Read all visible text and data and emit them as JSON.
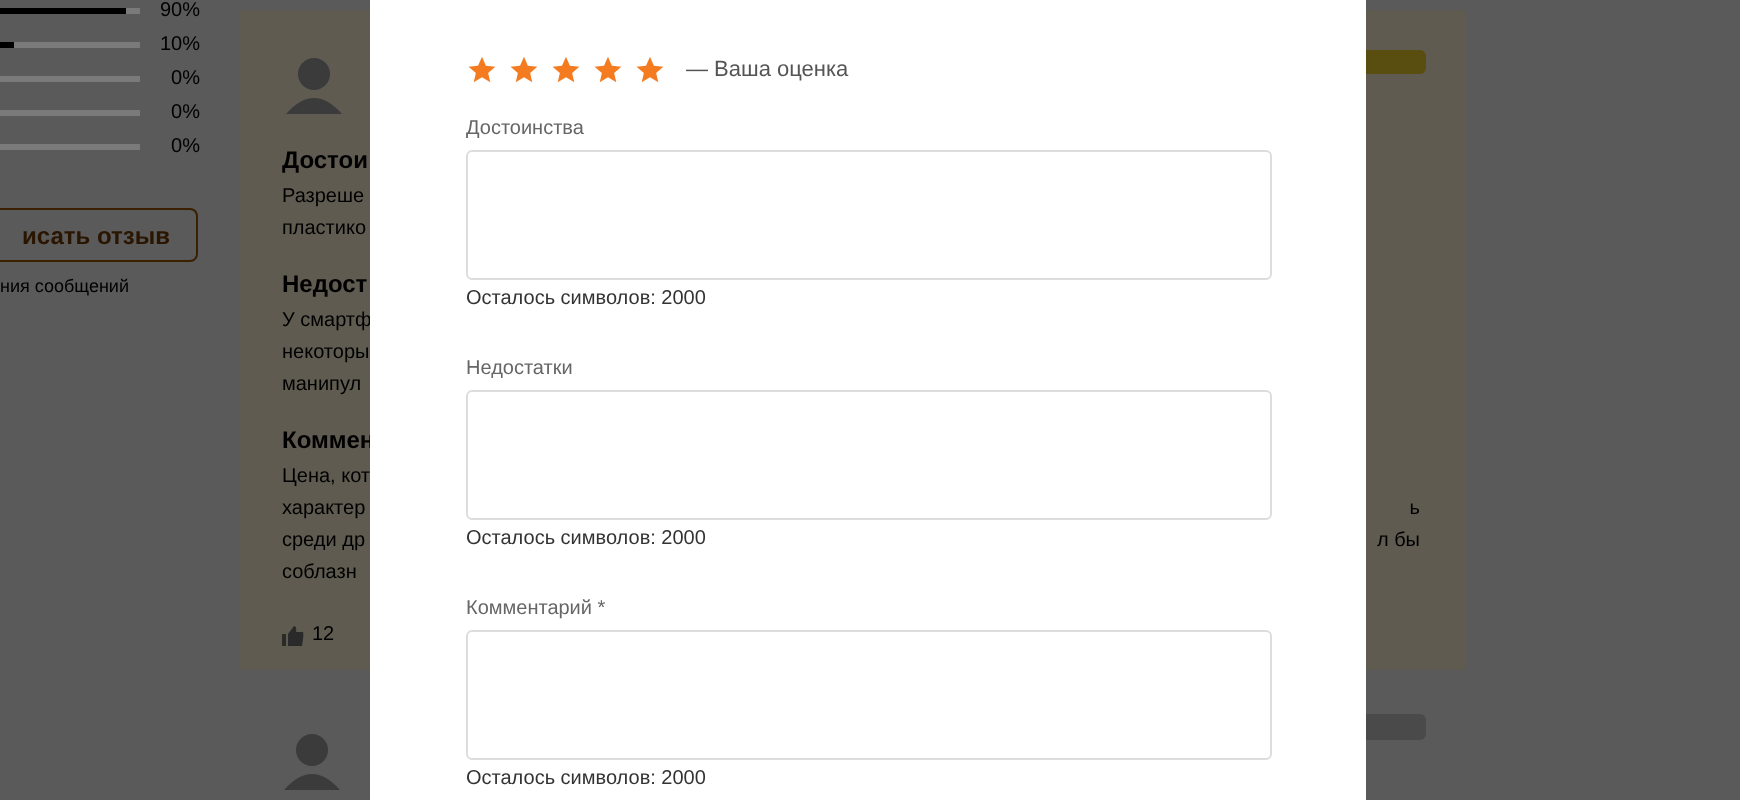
{
  "rating_bars": [
    {
      "level": 0.9,
      "percent": "90%"
    },
    {
      "level": 0.1,
      "percent": "10%"
    },
    {
      "level": 0,
      "percent": "0%"
    },
    {
      "level": 0,
      "percent": "0%"
    },
    {
      "level": 0,
      "percent": "0%"
    }
  ],
  "write_review_button": "исать отзыв",
  "rules_link": "ния сообщений",
  "review": {
    "sections": [
      {
        "heading": "Достои",
        "lines": [
          {
            "left": "Разреше"
          },
          {
            "left": "пластико"
          }
        ]
      },
      {
        "heading": "Недост",
        "lines": [
          {
            "left": "У смартф"
          },
          {
            "left": "некоторы"
          },
          {
            "left": "манипул"
          }
        ]
      },
      {
        "heading": "Коммен",
        "lines": [
          {
            "left": "Цена, кот"
          },
          {
            "left": "характер",
            "right": "ь"
          },
          {
            "left": "среди др",
            "right": "л бы"
          },
          {
            "left": "соблазн"
          }
        ]
      }
    ],
    "likes": "12"
  },
  "modal": {
    "stars": 5,
    "rating_caption": "— Ваша оценка",
    "fields": [
      {
        "label": "Достоинства",
        "counter": "Осталось символов: 2000"
      },
      {
        "label": "Недостатки",
        "counter": "Осталось символов: 2000"
      },
      {
        "label": "Комментарий *",
        "counter": "Осталось символов: 2000"
      }
    ]
  }
}
